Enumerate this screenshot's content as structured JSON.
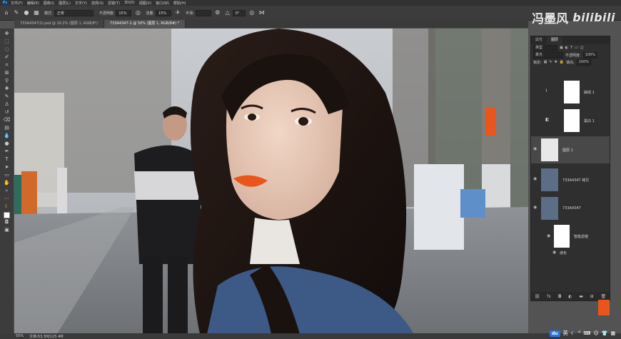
{
  "menubar": {
    "logo": "Ps",
    "items": [
      "文件(F)",
      "编辑(E)",
      "图像(I)",
      "图层(L)",
      "文字(Y)",
      "选择(S)",
      "滤镜(T)",
      "3D(D)",
      "视图(V)",
      "窗口(W)",
      "帮助(H)"
    ]
  },
  "options": {
    "mode_label": "模式:",
    "mode_value": "正常",
    "opacity_label": "不透明度:",
    "opacity_value": "15%",
    "flow_label": "流量:",
    "flow_value": "15%",
    "smooth_label": "平滑:",
    "angle_value": "0°"
  },
  "watermark": {
    "author": "冯墨风",
    "site": "bilibili"
  },
  "tabs": [
    {
      "label": "733A4347(1).psd @ 16.2% (图层 1, RGB/8*)"
    },
    {
      "label": "733A4347-1 @ 50% (图层 1, RGB/8#) *"
    }
  ],
  "panel": {
    "tabs": [
      "属性",
      "图层"
    ],
    "filter_value": "类型",
    "blend_value": "柔光",
    "opacity_label": "不透明度:",
    "opacity_value": "100%",
    "lock_label": "锁定:",
    "fill_label": "填充:",
    "fill_value": "100%",
    "layers": [
      "曲线 1",
      "黑白 1",
      "图层 1",
      "733A4347 拷贝",
      "733A4347",
      "智能滤镜",
      "液化"
    ]
  },
  "status": {
    "zoom": "50%",
    "doc": "文档:63.3M/125.4M"
  },
  "taskbar": {
    "du": "du",
    "lang": "英"
  },
  "colors": {
    "accent": "#31a8ff",
    "lipstick": "#e8561c"
  }
}
